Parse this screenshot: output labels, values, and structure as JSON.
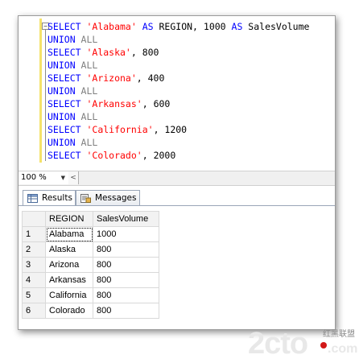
{
  "editor": {
    "lines": [
      [
        {
          "t": "SELECT ",
          "c": "kw"
        },
        {
          "t": "'Alabama'",
          "c": "str"
        },
        {
          "t": " ",
          "c": ""
        },
        {
          "t": "AS",
          "c": "kw"
        },
        {
          "t": " REGION, 1000 ",
          "c": ""
        },
        {
          "t": "AS",
          "c": "kw"
        },
        {
          "t": " SalesVolume",
          "c": ""
        }
      ],
      [
        {
          "t": "UNION",
          "c": "kw"
        },
        {
          "t": " ALL",
          "c": "gray"
        }
      ],
      [
        {
          "t": "SELECT ",
          "c": "kw"
        },
        {
          "t": "'Alaska'",
          "c": "str"
        },
        {
          "t": ", 800",
          "c": ""
        }
      ],
      [
        {
          "t": "UNION",
          "c": "kw"
        },
        {
          "t": " ALL",
          "c": "gray"
        }
      ],
      [
        {
          "t": "SELECT ",
          "c": "kw"
        },
        {
          "t": "'Arizona'",
          "c": "str"
        },
        {
          "t": ", 400",
          "c": ""
        }
      ],
      [
        {
          "t": "UNION",
          "c": "kw"
        },
        {
          "t": " ALL",
          "c": "gray"
        }
      ],
      [
        {
          "t": "SELECT ",
          "c": "kw"
        },
        {
          "t": "'Arkansas'",
          "c": "str"
        },
        {
          "t": ", 600",
          "c": ""
        }
      ],
      [
        {
          "t": "UNION",
          "c": "kw"
        },
        {
          "t": " ALL",
          "c": "gray"
        }
      ],
      [
        {
          "t": "SELECT ",
          "c": "kw"
        },
        {
          "t": "'California'",
          "c": "str"
        },
        {
          "t": ", 1200",
          "c": ""
        }
      ],
      [
        {
          "t": "UNION",
          "c": "kw"
        },
        {
          "t": " ALL",
          "c": "gray"
        }
      ],
      [
        {
          "t": "SELECT ",
          "c": "kw"
        },
        {
          "t": "'Colorado'",
          "c": "str"
        },
        {
          "t": ", 2000",
          "c": ""
        }
      ]
    ],
    "collapse_glyph": "−"
  },
  "zoom": {
    "value": "100 %",
    "arrow": "▼",
    "scroll_left": "<"
  },
  "tabs": [
    {
      "label": "Results"
    },
    {
      "label": "Messages"
    }
  ],
  "grid": {
    "columns": [
      "REGION",
      "SalesVolume"
    ],
    "rows": [
      {
        "n": "1",
        "region": "Alabama",
        "sales": "1000"
      },
      {
        "n": "2",
        "region": "Alaska",
        "sales": "800"
      },
      {
        "n": "3",
        "region": "Arizona",
        "sales": "800"
      },
      {
        "n": "4",
        "region": "Arkansas",
        "sales": "800"
      },
      {
        "n": "5",
        "region": "California",
        "sales": "800"
      },
      {
        "n": "6",
        "region": "Colorado",
        "sales": "800"
      }
    ]
  },
  "watermark": {
    "big": "2cto",
    "small": "红黑联盟",
    "suffix": ".com"
  },
  "colors": {
    "keyword": "#0000ff",
    "string": "#ff0000",
    "comment": "#808080",
    "margin": "#f5e26a"
  }
}
